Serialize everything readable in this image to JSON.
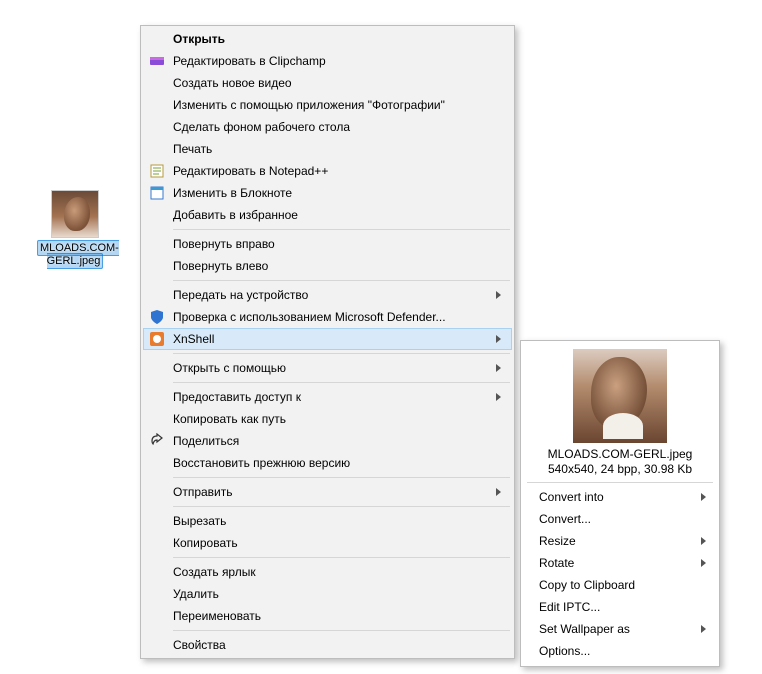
{
  "desktop": {
    "file_label": "MLOADS.COM-GERL.jpeg"
  },
  "menu": {
    "open": "Открыть",
    "clipchamp": "Редактировать в Clipchamp",
    "new_video": "Создать новое видео",
    "photos_app": "Изменить с помощью приложения \"Фотографии\"",
    "wallpaper": "Сделать фоном рабочего стола",
    "print": "Печать",
    "notepadpp": "Редактировать в Notepad++",
    "notepad": "Изменить в Блокноте",
    "favorites": "Добавить в избранное",
    "rotate_cw": "Повернуть вправо",
    "rotate_ccw": "Повернуть влево",
    "cast": "Передать на устройство",
    "defender": "Проверка с использованием Microsoft Defender...",
    "xnshell": "XnShell",
    "open_with": "Открыть с помощью",
    "give_access": "Предоставить доступ к",
    "copy_path": "Копировать как путь",
    "share": "Поделиться",
    "restore_prev": "Восстановить прежнюю версию",
    "send_to": "Отправить",
    "cut": "Вырезать",
    "copy": "Копировать",
    "shortcut": "Создать ярлык",
    "delete": "Удалить",
    "rename": "Переименовать",
    "properties": "Свойства"
  },
  "submenu": {
    "filename": "MLOADS.COM-GERL.jpeg",
    "metadata": "540x540, 24 bpp, 30.98 Kb",
    "convert_into": "Convert into",
    "convert": "Convert...",
    "resize": "Resize",
    "rotate": "Rotate",
    "copy_clip": "Copy to Clipboard",
    "edit_iptc": "Edit IPTC...",
    "set_wall": "Set Wallpaper as",
    "options": "Options..."
  }
}
